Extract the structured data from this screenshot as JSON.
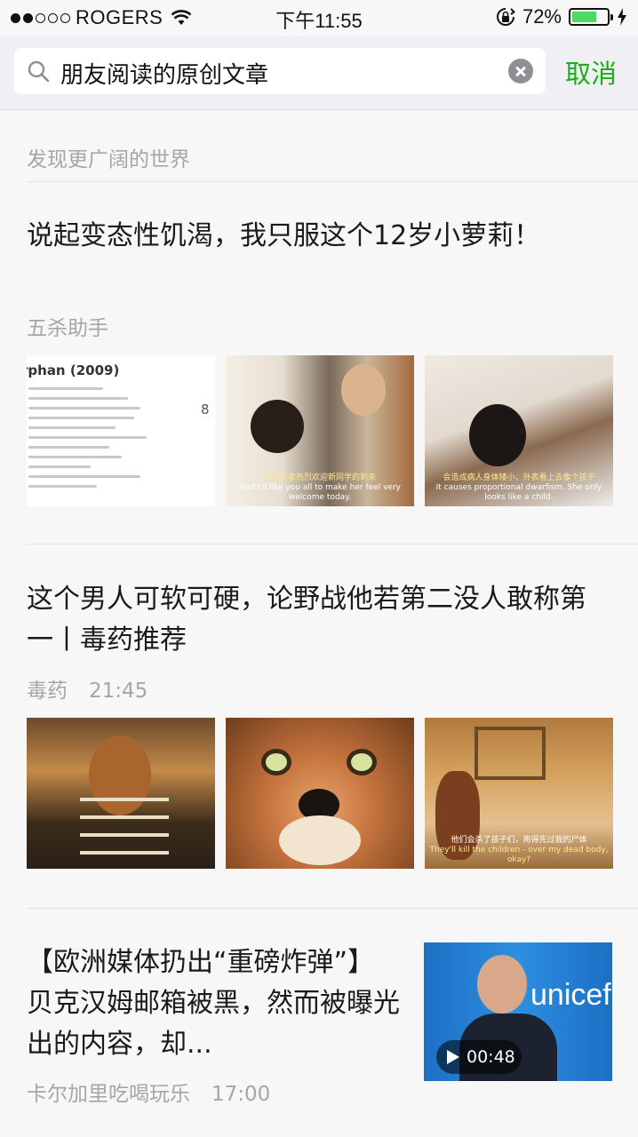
{
  "status_bar": {
    "carrier": "ROGERS",
    "time": "下午11:55",
    "battery_percent": "72%",
    "battery_level": 0.72
  },
  "search": {
    "query": "朋友阅读的原创文章",
    "cancel_label": "取消"
  },
  "feed": {
    "section_label": "发现更广阔的世界",
    "articles": [
      {
        "title": "说起变态性饥渴，我只服这个12岁小萝莉！",
        "source": "五杀助手",
        "time": "",
        "thumb_texts": {
          "info_title": "rphan (2009)",
          "info_number": "8",
          "sub2_cn": "希望大家热烈欢迎新同学的到来",
          "sub2_en": "And I'd like you all to make her feel very welcome today.",
          "sub3_cn": "会造成病人身体矮小，外表看上去像个孩子",
          "sub3_en": "It causes proportional dwarfism. She only looks like a child."
        }
      },
      {
        "title": "这个男人可软可硬，论野战他若第二没人敢称第一丨毒药推荐",
        "source": "毒药",
        "time": "21:45",
        "thumb_texts": {
          "sub3_cn": "他们会杀了孩子们，用得先过我的尸体",
          "sub3_en": "They'll kill the children - over my dead body, okay?"
        }
      },
      {
        "title": "【欧洲媒体扔出“重磅炸弹”】贝克汉姆邮箱被黑，然而被曝光出的内容，却...",
        "source": "卡尔加里吃喝玩乐",
        "time": "17:00",
        "video_duration": "00:48",
        "thumb_texts": {
          "sign": "unicef"
        }
      }
    ]
  },
  "colors": {
    "accent_green": "#1aad19",
    "muted_text": "#a6a6a6"
  }
}
